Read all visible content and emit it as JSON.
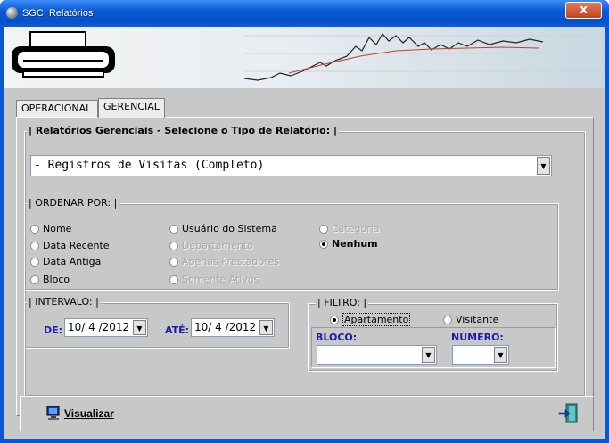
{
  "window": {
    "title": "SGC: Relatórios",
    "close_label": "x"
  },
  "tabs": [
    {
      "label": "OPERACIONAL"
    },
    {
      "label": "GERENCIAL"
    }
  ],
  "report_type": {
    "legend": "| Relatórios Gerenciais - Selecione o Tipo de Relatório: |",
    "selected": " - Registros de Visitas (Completo)"
  },
  "order_by": {
    "legend": "| ORDENAR POR: |",
    "options": [
      {
        "label": "Nome",
        "checked": false,
        "enabled": true
      },
      {
        "label": "Data Recente",
        "checked": false,
        "enabled": true
      },
      {
        "label": "Data Antiga",
        "checked": false,
        "enabled": true
      },
      {
        "label": "Bloco",
        "checked": false,
        "enabled": true
      },
      {
        "label": "Usuário do Sistema",
        "checked": false,
        "enabled": true
      },
      {
        "label": "Departamento",
        "checked": false,
        "enabled": false
      },
      {
        "label": "Apenas Prestadores",
        "checked": false,
        "enabled": false
      },
      {
        "label": "Somente Ativos",
        "checked": false,
        "enabled": false
      },
      {
        "label": "Categoria",
        "checked": false,
        "enabled": false
      },
      {
        "label": "Nenhum",
        "checked": true,
        "enabled": true
      }
    ]
  },
  "interval": {
    "legend": "| INTERVALO: |",
    "from_label": "DE:",
    "from_value": "10/ 4 /2012",
    "to_label": "ATÉ:",
    "to_value": "10/ 4 /2012"
  },
  "filter": {
    "legend": "| FILTRO: |",
    "option_apartment": "Apartamento",
    "option_visitor": "Visitante",
    "block_label": "BLOCO:",
    "number_label": "NÚMERO:",
    "block_value": "",
    "number_value": ""
  },
  "footer": {
    "view_label": "Visualizar"
  },
  "colors": {
    "titlebar": "#0a5ad6",
    "accent_blue": "#1c1ca8",
    "panel": "#c8c8c8"
  }
}
